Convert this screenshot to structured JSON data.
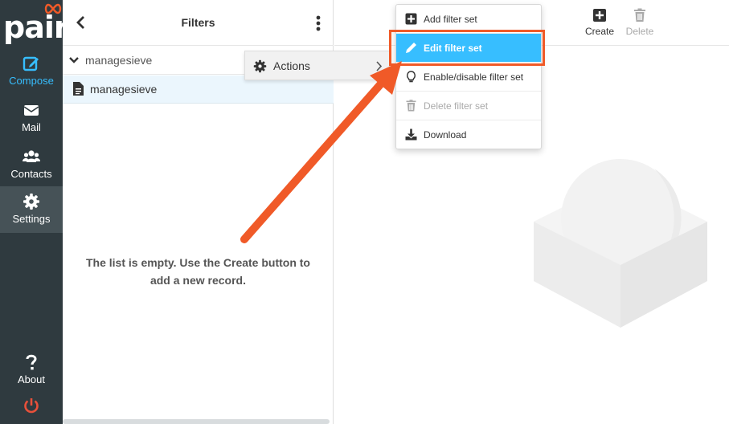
{
  "brand": {
    "logo_text": "pair",
    "accent_color": "#37beff",
    "sidebar_color": "#2f3a3f",
    "highlight_color": "#f05a28"
  },
  "sidebar": {
    "items": [
      {
        "label": "Compose",
        "icon": "compose-icon"
      },
      {
        "label": "Mail",
        "icon": "mail-icon"
      },
      {
        "label": "Contacts",
        "icon": "contacts-icon"
      },
      {
        "label": "Settings",
        "icon": "gear-icon"
      },
      {
        "label": "About",
        "icon": "question-icon"
      },
      {
        "label": "",
        "icon": "power-icon"
      }
    ]
  },
  "list_pane": {
    "title": "Filters",
    "filter_set_group": "managesieve",
    "filter_set_item": "managesieve",
    "empty_message": "The list is empty. Use the Create button to add a new record."
  },
  "toolbar": {
    "create_label": "Create",
    "delete_label": "Delete"
  },
  "actions": {
    "label": "Actions"
  },
  "menu": {
    "items": [
      {
        "label": "Add filter set",
        "icon": "plus-square-icon"
      },
      {
        "label": "Edit filter set",
        "icon": "pencil-icon"
      },
      {
        "label": "Enable/disable filter set",
        "icon": "lightbulb-icon"
      },
      {
        "label": "Delete filter set",
        "icon": "trash-icon"
      },
      {
        "label": "Download",
        "icon": "download-icon"
      }
    ]
  }
}
